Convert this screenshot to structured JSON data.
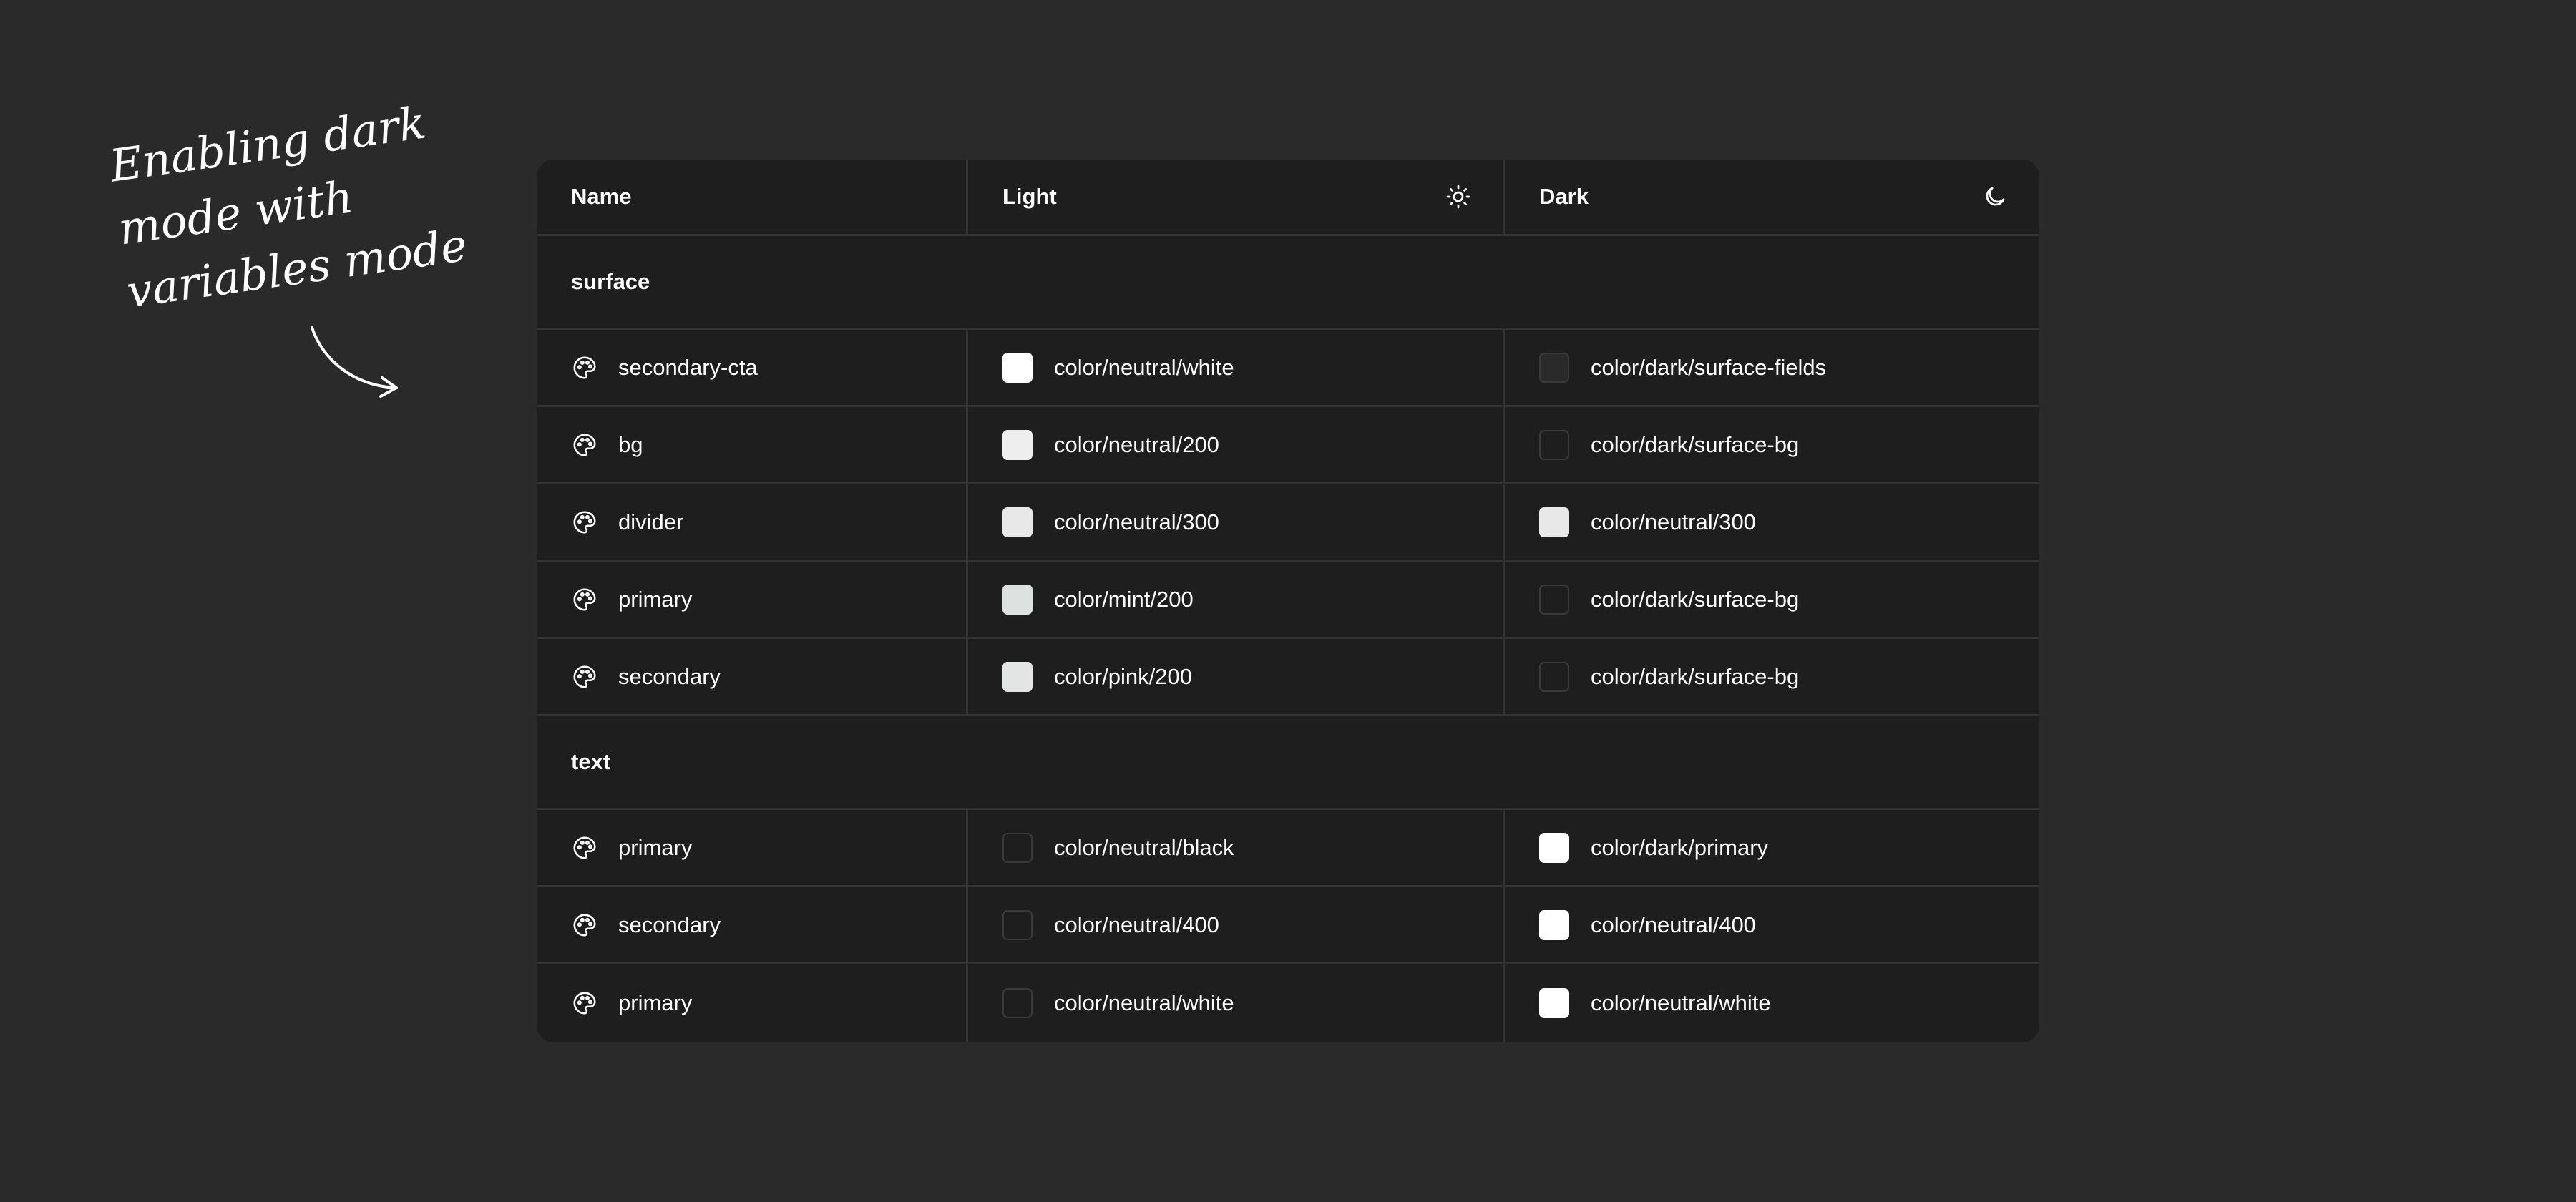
{
  "annotation": {
    "line1": "Enabling dark",
    "line2": "mode with",
    "line3": "variables mode"
  },
  "header": {
    "name": "Name",
    "light": "Light",
    "dark": "Dark",
    "light_icon": "sun-icon",
    "dark_icon": "moon-icon"
  },
  "groups": [
    {
      "label": "surface",
      "rows": [
        {
          "name": "secondary-cta",
          "light": "color/neutral/white",
          "dark": "color/dark/surface-fields",
          "light_swatch": "#ffffff",
          "dark_swatch": "#2a2a2a"
        },
        {
          "name": "bg",
          "light": "color/neutral/200",
          "dark": "color/dark/surface-bg",
          "light_swatch": "#eeeeee",
          "dark_swatch": "#1e1e1e"
        },
        {
          "name": "divider",
          "light": "color/neutral/300",
          "dark": "color/neutral/300",
          "light_swatch": "#e8e8e8",
          "dark_swatch": "#e8e8e8"
        },
        {
          "name": "primary",
          "light": "color/mint/200",
          "dark": "color/dark/surface-bg",
          "light_swatch": "#dde1e0",
          "dark_swatch": "#1e1e1e"
        },
        {
          "name": "secondary",
          "light": "color/pink/200",
          "dark": "color/dark/surface-bg",
          "light_swatch": "#e3e5e4",
          "dark_swatch": "#1e1e1e"
        }
      ]
    },
    {
      "label": "text",
      "rows": [
        {
          "name": "primary",
          "light": "color/neutral/black",
          "dark": "color/dark/primary",
          "light_swatch": "#1e1e1e",
          "dark_swatch": "#ffffff"
        },
        {
          "name": "secondary",
          "light": "color/neutral/400",
          "dark": "color/neutral/400",
          "light_swatch": "#1e1e1e",
          "dark_swatch": "#ffffff"
        },
        {
          "name": "primary",
          "light": "color/neutral/white",
          "dark": "color/neutral/white",
          "light_swatch": "#1e1e1e",
          "dark_swatch": "#ffffff"
        }
      ]
    }
  ],
  "colors": {
    "page_bg": "#2a2a2a",
    "table_bg": "#1e1e1e",
    "divider": "#333333",
    "text": "#ffffff"
  },
  "row_icon": "palette-icon"
}
